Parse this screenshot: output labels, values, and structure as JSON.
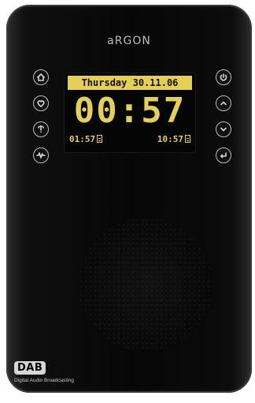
{
  "brand": "aRGON",
  "display": {
    "date": "Thursday 30.11.06",
    "time": "00:57",
    "alarms": [
      "01:57",
      "10:57"
    ]
  },
  "buttons": {
    "left": [
      {
        "name": "home-button",
        "icon": "home-icon"
      },
      {
        "name": "favorites-button",
        "icon": "heart-icon"
      },
      {
        "name": "info-button",
        "icon": "info-icon"
      },
      {
        "name": "signal-button",
        "icon": "signal-icon"
      }
    ],
    "right": [
      {
        "name": "power-button",
        "icon": "power-icon"
      },
      {
        "name": "up-button",
        "icon": "chevron-up-icon"
      },
      {
        "name": "down-button",
        "icon": "chevron-down-icon"
      },
      {
        "name": "select-button",
        "icon": "enter-icon"
      }
    ]
  },
  "dab": {
    "logo": "DAB",
    "caption": "Digital Audio Broadcasting"
  },
  "colors": {
    "display": "#e6cf55",
    "body": "#070707"
  }
}
